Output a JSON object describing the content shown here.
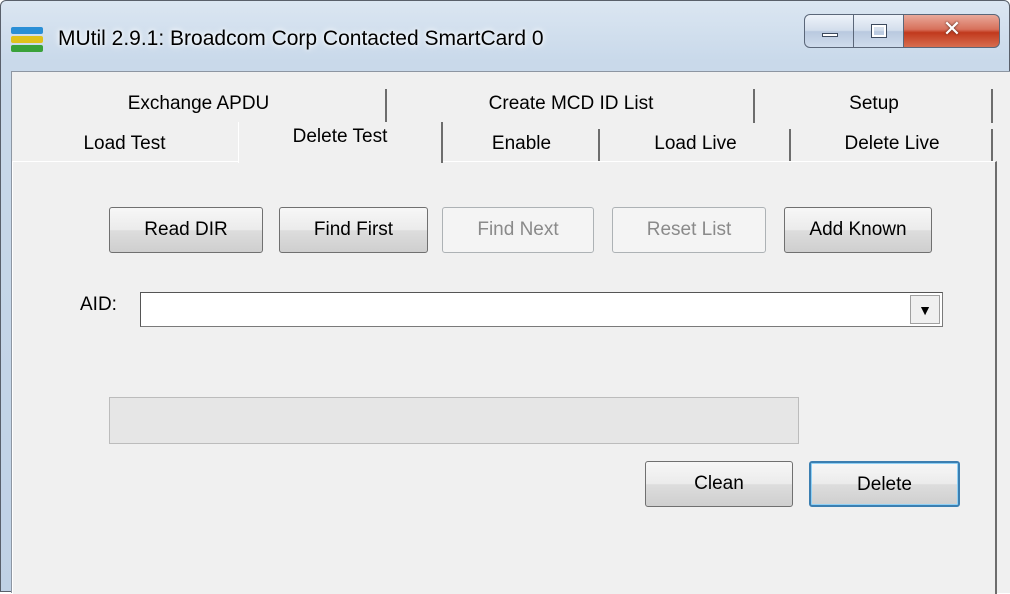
{
  "window": {
    "title": "MUtil 2.9.1: Broadcom Corp Contacted SmartCard 0",
    "icon": "app-stripes-icon",
    "controls": {
      "minimize": "minimize-icon",
      "maximize": "maximize-icon",
      "close": "✕"
    }
  },
  "tabs": {
    "row_back": [
      {
        "label": "Exchange APDU"
      },
      {
        "label": "Create MCD ID List"
      },
      {
        "label": "Setup"
      }
    ],
    "row_front": [
      {
        "label": "Load Test"
      },
      {
        "label": "Delete Test"
      },
      {
        "label": "Enable"
      },
      {
        "label": "Load Live"
      },
      {
        "label": "Delete Live"
      }
    ],
    "active": "Delete Test"
  },
  "actions": {
    "read_dir": "Read DIR",
    "find_first": "Find First",
    "find_next": "Find Next",
    "reset_list": "Reset List",
    "add_known": "Add Known"
  },
  "aid": {
    "label": "AID:",
    "value": ""
  },
  "progress": {
    "value": 0
  },
  "bottom": {
    "clean": "Clean",
    "delete": "Delete"
  },
  "colors": {
    "progress_fill": "#06b025",
    "default_button_border": "#3c7fb1"
  }
}
